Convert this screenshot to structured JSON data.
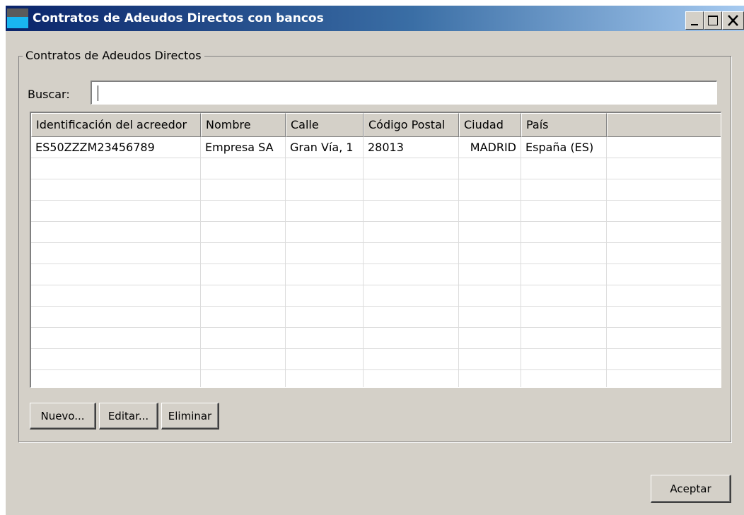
{
  "window": {
    "title": "Contratos de Adeudos Directos con bancos"
  },
  "group": {
    "legend": "Contratos de Adeudos Directos"
  },
  "search": {
    "label": "Buscar:",
    "value": "",
    "placeholder": ""
  },
  "table": {
    "columns": [
      "Identificación del acreedor",
      "Nombre",
      "Calle",
      "Código Postal",
      "Ciudad",
      "País",
      ""
    ],
    "rows": [
      [
        "ES50ZZZM23456789",
        "Empresa SA",
        "Gran Vía, 1",
        "28013",
        "MADRID",
        "España (ES)",
        ""
      ]
    ]
  },
  "buttons": {
    "new_label": "Nuevo...",
    "edit_label": "Editar...",
    "delete_label": "Eliminar",
    "accept_label": "Aceptar"
  },
  "colors": {
    "titlebar_start": "#0a246a",
    "titlebar_end": "#a6caf0",
    "dialog_bg": "#d4d0c8"
  },
  "icons": {
    "app": "app-icon",
    "minimize": "minimize-icon",
    "maximize": "maximize-icon",
    "close": "close-icon"
  }
}
